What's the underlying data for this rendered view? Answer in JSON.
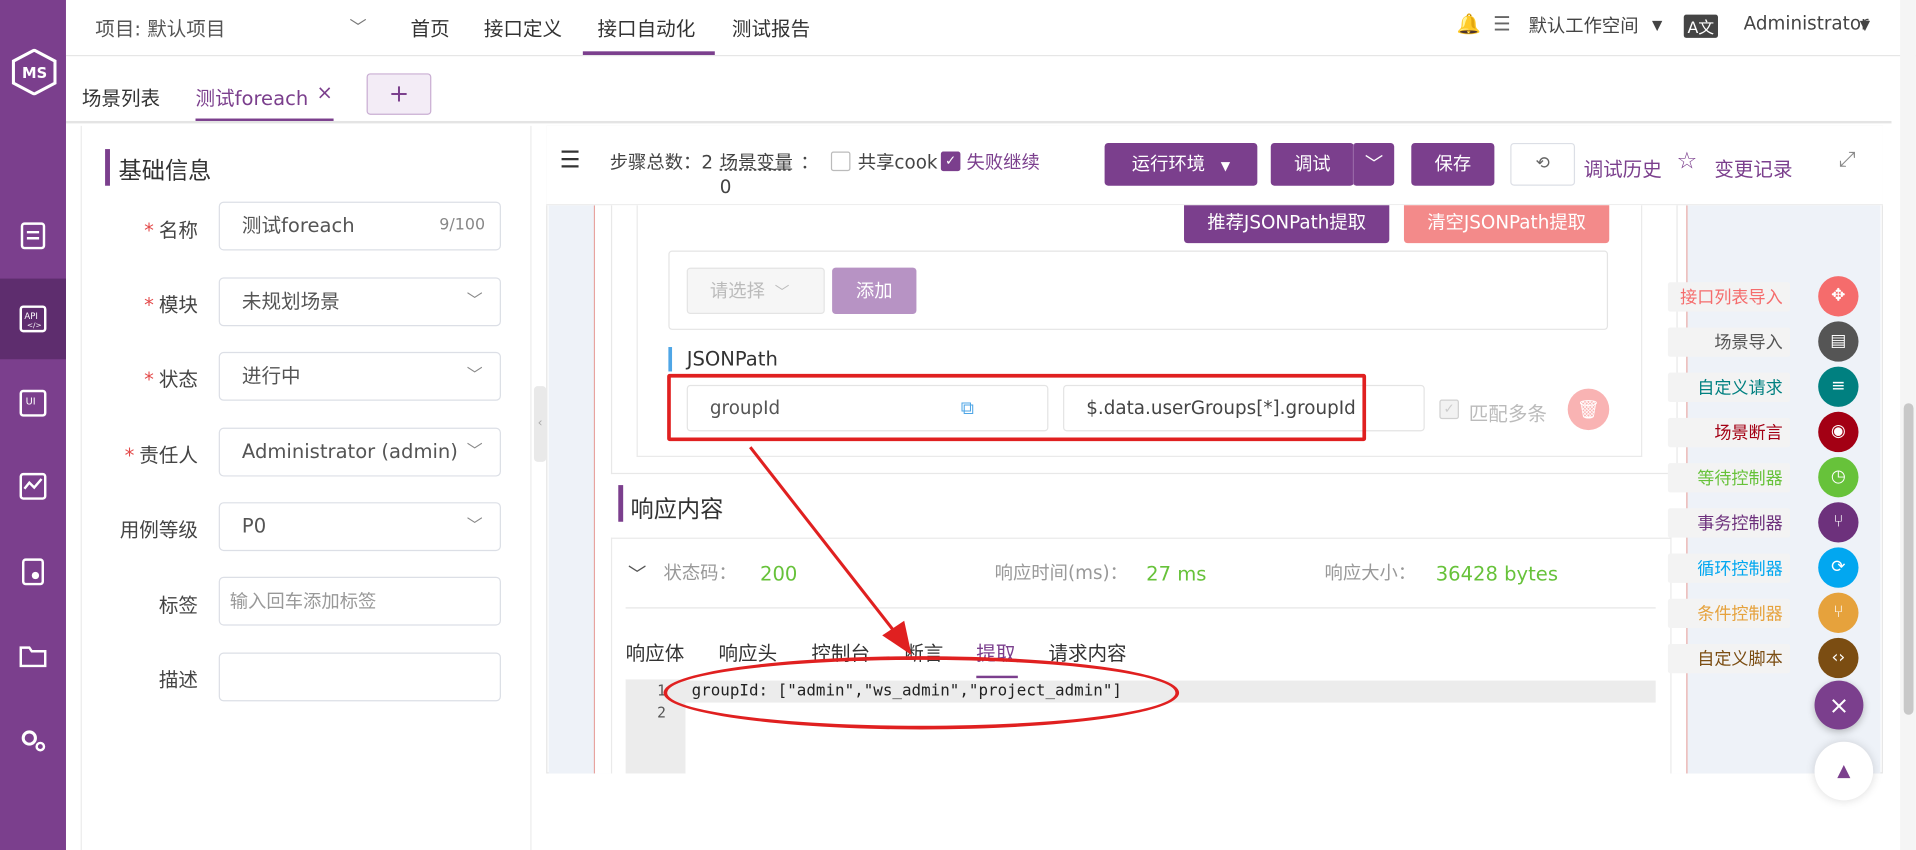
{
  "header": {
    "project": "项目: 默认项目",
    "nav": [
      "首页",
      "接口定义",
      "接口自动化",
      "测试报告"
    ],
    "workspace": "默认工作空间",
    "user": "Administrator"
  },
  "tabs": {
    "list": "场景列表",
    "current": "测试foreach",
    "add": "+"
  },
  "basic": {
    "title": "基础信息",
    "fields": {
      "name_label": "名称",
      "name_value": "测试foreach",
      "name_count": "9/100",
      "module_label": "模块",
      "module_value": "未规划场景",
      "status_label": "状态",
      "status_value": "进行中",
      "owner_label": "责任人",
      "owner_value": "Administrator (admin)",
      "level_label": "用例等级",
      "level_value": "P0",
      "tag_label": "标签",
      "tag_placeholder": "输入回车添加标签",
      "desc_label": "描述"
    }
  },
  "toolbar": {
    "steps": "步骤总数：2",
    "vars": "场景变量",
    "vars_colon": "：",
    "vars_count": "0",
    "share_cookie": "共享cook",
    "fail_continue": "失败继续",
    "env": "运行环境",
    "debug": "调试",
    "save": "保存",
    "history": "调试历史",
    "changes": "变更记录"
  },
  "extract": {
    "recommend": "推荐JSONPath提取",
    "clear": "清空JSONPath提取",
    "select_placeholder": "请选择",
    "add": "添加",
    "jsonpath_label": "JSONPath",
    "var_name": "groupId",
    "expression": "$.data.userGroups[*].groupId",
    "multi": "匹配多条"
  },
  "response": {
    "title": "响应内容",
    "status_label": "状态码：",
    "status_value": "200",
    "time_label": "响应时间(ms)：",
    "time_value": "27 ms",
    "size_label": "响应大小：",
    "size_value": "36428 bytes",
    "tabs": [
      "响应体",
      "响应头",
      "控制台",
      "断言",
      "提取",
      "请求内容"
    ],
    "active_tab": "提取",
    "code_line1": "groupId: [\"admin\",\"ws_admin\",\"project_admin\"]",
    "line_numbers": [
      "1",
      "2"
    ]
  },
  "side_tools": [
    {
      "label": "接口列表导入",
      "color": "#f56c6c",
      "icon": "move-icon"
    },
    {
      "label": "场景导入",
      "color": "#555555",
      "icon": "film-icon"
    },
    {
      "label": "自定义请求",
      "color": "#008080",
      "icon": "sliders-icon"
    },
    {
      "label": "场景断言",
      "color": "#a30014",
      "icon": "assert-icon"
    },
    {
      "label": "等待控制器",
      "color": "#67c23a",
      "icon": "clock-icon"
    },
    {
      "label": "事务控制器",
      "color": "#6d317c",
      "icon": "branch-icon"
    },
    {
      "label": "循环控制器",
      "color": "#02a7f0",
      "icon": "loop-icon"
    },
    {
      "label": "条件控制器",
      "color": "#e6a23c",
      "icon": "fork-icon"
    },
    {
      "label": "自定义脚本",
      "color": "#7b4d12",
      "icon": "code-icon"
    }
  ]
}
